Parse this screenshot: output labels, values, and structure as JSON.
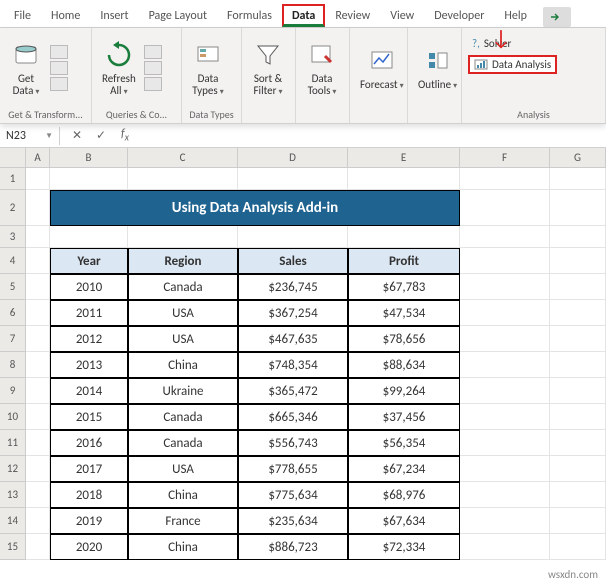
{
  "tabs": [
    "File",
    "Home",
    "Insert",
    "Page Layout",
    "Formulas",
    "Data",
    "Review",
    "View",
    "Developer",
    "Help"
  ],
  "active_tab": "Data",
  "ribbon": {
    "get_data": "Get\nData",
    "refresh": "Refresh\nAll",
    "data_types": "Data\nTypes",
    "sort_filter": "Sort &\nFilter",
    "data_tools": "Data\nTools",
    "forecast": "Forecast",
    "outline": "Outline",
    "solver": "Solver",
    "data_analysis": "Data Analysis",
    "groups": {
      "transform": "Get & Transform...",
      "queries": "Queries & Co...",
      "types": "Data Types",
      "analysis": "Analysis"
    }
  },
  "namebox": "N23",
  "col_headers": [
    "A",
    "B",
    "C",
    "D",
    "E",
    "F",
    "G"
  ],
  "row_numbers": [
    1,
    2,
    3,
    4,
    5,
    6,
    7,
    8,
    9,
    10,
    11,
    12,
    13,
    14,
    15
  ],
  "title": "Using Data Analysis Add-in",
  "headers": [
    "Year",
    "Region",
    "Sales",
    "Profit"
  ],
  "rows": [
    {
      "year": "2010",
      "region": "Canada",
      "sales": "$236,745",
      "profit": "$67,783"
    },
    {
      "year": "2011",
      "region": "USA",
      "sales": "$367,254",
      "profit": "$47,534"
    },
    {
      "year": "2012",
      "region": "USA",
      "sales": "$467,635",
      "profit": "$78,656"
    },
    {
      "year": "2013",
      "region": "China",
      "sales": "$748,354",
      "profit": "$88,634"
    },
    {
      "year": "2014",
      "region": "Ukraine",
      "sales": "$365,472",
      "profit": "$99,264"
    },
    {
      "year": "2015",
      "region": "Canada",
      "sales": "$665,346",
      "profit": "$37,456"
    },
    {
      "year": "2016",
      "region": "Canada",
      "sales": "$556,743",
      "profit": "$56,354"
    },
    {
      "year": "2017",
      "region": "USA",
      "sales": "$778,655",
      "profit": "$67,234"
    },
    {
      "year": "2018",
      "region": "China",
      "sales": "$775,634",
      "profit": "$68,976"
    },
    {
      "year": "2019",
      "region": "France",
      "sales": "$235,634",
      "profit": "$67,634"
    },
    {
      "year": "2020",
      "region": "China",
      "sales": "$886,723",
      "profit": "$72,334"
    }
  ],
  "chart_data": {
    "type": "table",
    "title": "Using Data Analysis Add-in",
    "columns": [
      "Year",
      "Region",
      "Sales",
      "Profit"
    ],
    "data": [
      [
        2010,
        "Canada",
        236745,
        67783
      ],
      [
        2011,
        "USA",
        367254,
        47534
      ],
      [
        2012,
        "USA",
        467635,
        78656
      ],
      [
        2013,
        "China",
        748354,
        88634
      ],
      [
        2014,
        "Ukraine",
        365472,
        99264
      ],
      [
        2015,
        "Canada",
        665346,
        37456
      ],
      [
        2016,
        "Canada",
        556743,
        56354
      ],
      [
        2017,
        "USA",
        778655,
        67234
      ],
      [
        2018,
        "China",
        775634,
        68976
      ],
      [
        2019,
        "France",
        235634,
        67634
      ],
      [
        2020,
        "China",
        886723,
        72334
      ]
    ]
  },
  "watermark": "wsxdn.com"
}
